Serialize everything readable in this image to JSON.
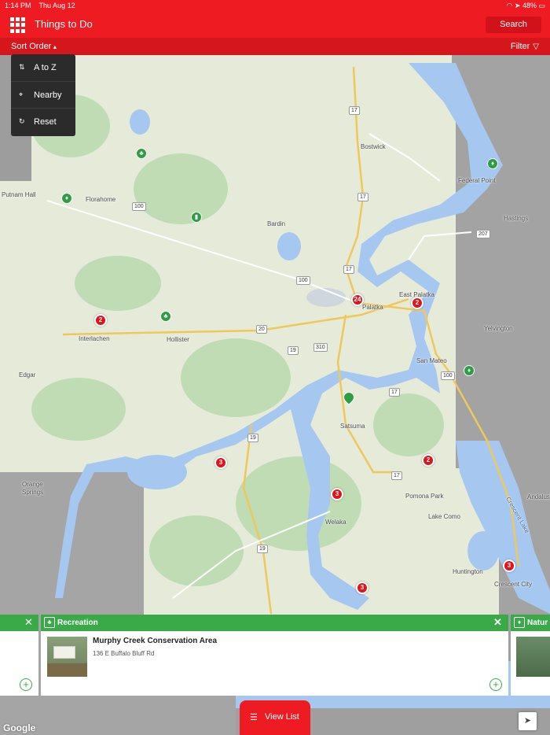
{
  "status_bar": {
    "time": "1:14 PM",
    "date": "Thu Aug 12",
    "battery": "48%"
  },
  "header": {
    "title": "Things to Do",
    "search_label": "Search",
    "menu_icon": "grid-icon"
  },
  "subbar": {
    "sort_label": "Sort Order",
    "filter_label": "Filter"
  },
  "sort_menu": {
    "items": [
      {
        "icon": "sort-az-icon",
        "label": "A to Z"
      },
      {
        "icon": "nearby-icon",
        "label": "Nearby"
      },
      {
        "icon": "reset-icon",
        "label": "Reset"
      }
    ]
  },
  "map": {
    "towns": [
      "Putnam Hall",
      "Florahome",
      "Bostwick",
      "Federal Point",
      "Hastings",
      "Bardin",
      "East Palatka",
      "Palatka",
      "Yelvington",
      "Interlachen",
      "Hollister",
      "San Mateo",
      "Edgar",
      "Satsuma",
      "Orange Springs",
      "Pomona Park",
      "Lake Como",
      "Welaka",
      "Huntington",
      "Crescent City",
      "Andalusia",
      "Crescent Lake"
    ],
    "route_shields": [
      "17",
      "17",
      "100",
      "207",
      "17",
      "100",
      "20",
      "19",
      "310",
      "100",
      "17",
      "19",
      "17",
      "19"
    ],
    "clusters": [
      "2",
      "24",
      "2",
      "3",
      "3",
      "2",
      "3",
      "3"
    ],
    "attribution": "Google"
  },
  "cards": {
    "main": {
      "category": "Recreation",
      "category_icon": "recreation-icon",
      "name": "Murphy Creek Conservation Area",
      "address": "136 E Buffalo Bluff Rd"
    },
    "right": {
      "category": "Natur"
    }
  },
  "view_list_label": "View List",
  "colors": {
    "primary_red": "#ee1b22",
    "category_green": "#3aaa49",
    "water": "#a6c8f0"
  }
}
